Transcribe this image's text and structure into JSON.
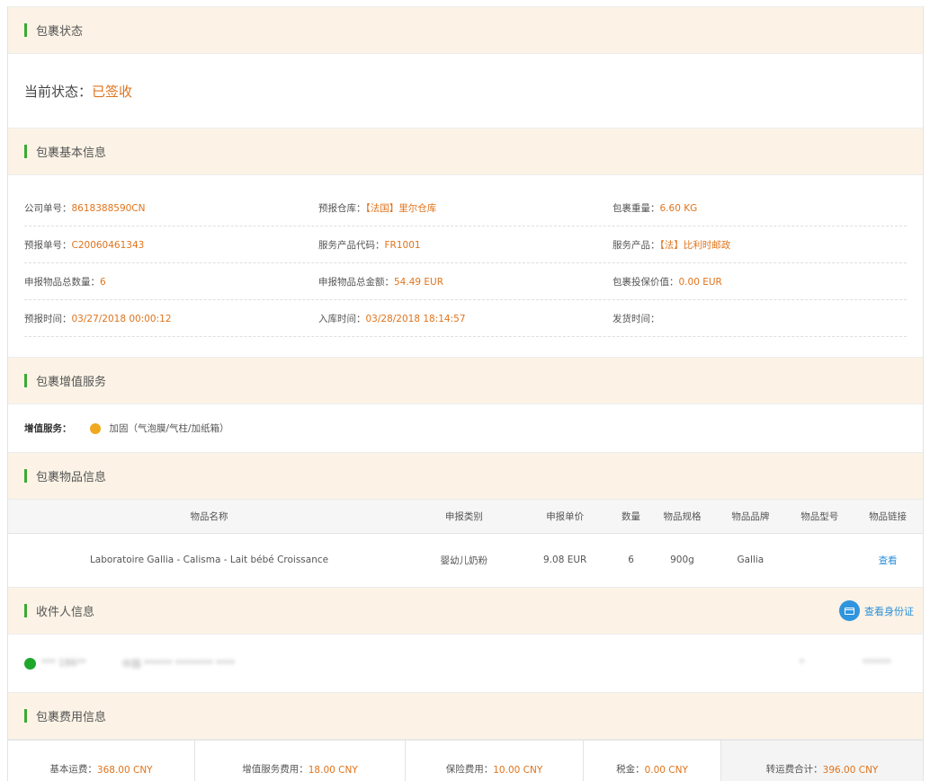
{
  "status_section": {
    "title": "包裹状态",
    "label": "当前状态：",
    "value": "已签收"
  },
  "basic_section": {
    "title": "包裹基本信息",
    "rows": [
      [
        {
          "k": "公司单号：",
          "v": "8618388590CN"
        },
        {
          "k": "预报仓库：",
          "v": "【法国】里尔仓库"
        },
        {
          "k": "包裹重量：",
          "v": "6.60 KG"
        }
      ],
      [
        {
          "k": "预报单号：",
          "v": "C20060461343"
        },
        {
          "k": "服务产品代码：",
          "v": "FR1001"
        },
        {
          "k": "服务产品：",
          "v": "【法】比利时邮政"
        }
      ],
      [
        {
          "k": "申报物品总数量：",
          "v": "6"
        },
        {
          "k": "申报物品总金额：",
          "v": "54.49 EUR"
        },
        {
          "k": "包裹投保价值：",
          "v": "0.00 EUR"
        }
      ],
      [
        {
          "k": "预报时间：",
          "v": "03/27/2018 00:00:12"
        },
        {
          "k": "入库时间：",
          "v": "03/28/2018 18:14:57"
        },
        {
          "k": "发货时间：",
          "v": ""
        }
      ]
    ]
  },
  "vas_section": {
    "title": "包裹增值服务",
    "label": "增值服务：",
    "item": "加固（气泡膜/气柱/加纸箱）",
    "dot_color": "#f0a81e"
  },
  "items_section": {
    "title": "包裹物品信息",
    "headers": [
      "物品名称",
      "申报类别",
      "申报单价",
      "数量",
      "物品规格",
      "物品品牌",
      "物品型号",
      "物品链接"
    ],
    "rows": [
      [
        "Laboratoire Gallia - Calisma - Lait bébé Croissance",
        "婴幼儿奶粉",
        "9.08 EUR",
        "6",
        "900g",
        "Gallia",
        "",
        "查看"
      ]
    ]
  },
  "recipient_section": {
    "title": "收件人信息",
    "id_button": "查看身份证",
    "name": "*** 186**",
    "address": "中国 ****** ******** ****",
    "extra1": "*",
    "extra2": "******"
  },
  "fee_section": {
    "title": "包裹费用信息",
    "fees": [
      {
        "k": "基本运费：",
        "v": "368.00 CNY"
      },
      {
        "k": "增值服务费用：",
        "v": "18.00 CNY"
      },
      {
        "k": "保险费用：",
        "v": "10.00 CNY"
      },
      {
        "k": "税金：",
        "v": "0.00 CNY"
      },
      {
        "k": "转运费合计：",
        "v": "396.00 CNY"
      }
    ]
  },
  "colors": {
    "accent_orange": "#e0741c",
    "link_blue": "#2b8fd8",
    "section_bar": "#3aaa35",
    "header_bg": "#fcf3e6"
  }
}
